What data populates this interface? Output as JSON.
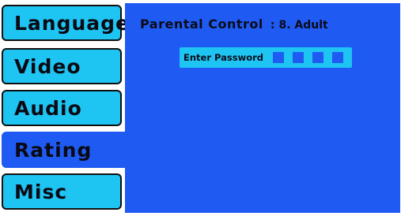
{
  "menu": {
    "items": [
      {
        "label": "Language",
        "active": false
      },
      {
        "label": "Video",
        "active": false
      },
      {
        "label": "Audio",
        "active": false
      },
      {
        "label": "Rating",
        "active": true
      },
      {
        "label": "Misc",
        "active": false
      }
    ]
  },
  "rating": {
    "parental_control_label": "Parental Control",
    "parental_control_separator": ":",
    "parental_control_value": "8. Adult",
    "password_label": "Enter Password",
    "password_digits_count": 4
  },
  "colors": {
    "menu_item_bg": "#1ec4f2",
    "active_bg": "#1f5bf2",
    "text": "#0b0b1a"
  }
}
